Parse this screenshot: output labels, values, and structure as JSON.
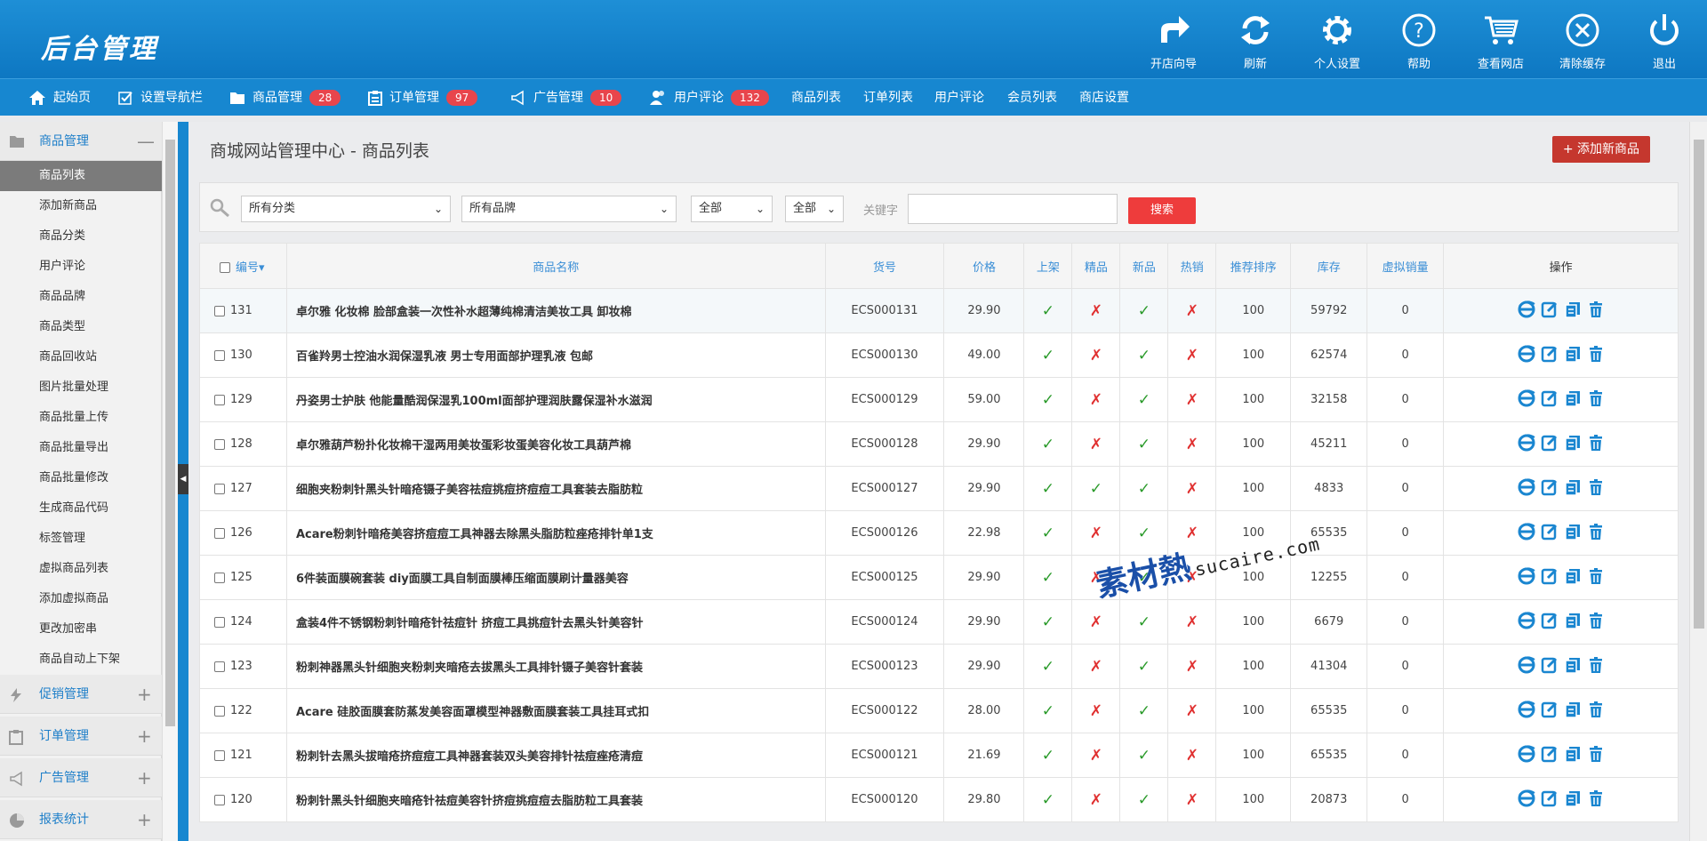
{
  "header": {
    "title": "后台管理",
    "tools": [
      {
        "label": "开店向导",
        "icon": "share-arrow-icon"
      },
      {
        "label": "刷新",
        "icon": "refresh-icon"
      },
      {
        "label": "个人设置",
        "icon": "gear-icon"
      },
      {
        "label": "帮助",
        "icon": "help-icon"
      },
      {
        "label": "查看网店",
        "icon": "cart-icon"
      },
      {
        "label": "清除缓存",
        "icon": "close-circle-icon"
      },
      {
        "label": "退出",
        "icon": "power-icon"
      }
    ]
  },
  "nav": {
    "items": [
      {
        "label": "起始页",
        "icon": "home-icon"
      },
      {
        "label": "设置导航栏",
        "icon": "checkbox-icon"
      },
      {
        "label": "商品管理",
        "icon": "folder-icon",
        "badge": "28"
      },
      {
        "label": "订单管理",
        "icon": "clipboard-icon",
        "badge": "97"
      },
      {
        "label": "广告管理",
        "icon": "megaphone-icon",
        "badge": "10"
      },
      {
        "label": "用户评论",
        "icon": "users-icon",
        "badge": "132"
      },
      {
        "label": "商品列表"
      },
      {
        "label": "订单列表"
      },
      {
        "label": "用户评论"
      },
      {
        "label": "会员列表"
      },
      {
        "label": "商店设置"
      }
    ]
  },
  "sidebar": {
    "groups": [
      {
        "label": "商品管理",
        "toggle": "—",
        "icon": "folder-icon"
      },
      {
        "label": "促销管理",
        "toggle": "+",
        "icon": "bolt-icon"
      },
      {
        "label": "订单管理",
        "toggle": "+",
        "icon": "clipboard-icon"
      },
      {
        "label": "广告管理",
        "toggle": "+",
        "icon": "megaphone-icon"
      },
      {
        "label": "报表统计",
        "toggle": "+",
        "icon": "pie-chart-icon"
      }
    ],
    "items": [
      "商品列表",
      "添加新商品",
      "商品分类",
      "用户评论",
      "商品品牌",
      "商品类型",
      "商品回收站",
      "图片批量处理",
      "商品批量上传",
      "商品批量导出",
      "商品批量修改",
      "生成商品代码",
      "标签管理",
      "虚拟商品列表",
      "添加虚拟商品",
      "更改加密串",
      "商品自动上下架"
    ],
    "active_item": "商品列表"
  },
  "page": {
    "breadcrumb": "商城网站管理中心 - 商品列表",
    "add_button": "添加新商品",
    "add_button_icon": "+"
  },
  "filter": {
    "category": "所有分类",
    "brand": "所有品牌",
    "status1": "全部",
    "status2": "全部",
    "keyword_label": "关键字",
    "keyword_value": "",
    "search_button": "搜索"
  },
  "table": {
    "headers": [
      "编号",
      "商品名称",
      "货号",
      "价格",
      "上架",
      "精品",
      "新品",
      "热销",
      "推荐排序",
      "库存",
      "虚拟销量",
      "操作"
    ],
    "sort_indicator": "▾",
    "yes_mark": "✓",
    "no_mark": "✗",
    "rows": [
      {
        "id": "131",
        "name": "卓尔雅 化妆棉 脸部盒装一次性补水超薄纯棉清洁美妆工具 卸妆棉",
        "sn": "ECS000131",
        "price": "29.90",
        "onsale": true,
        "best": false,
        "new": true,
        "hot": false,
        "sort": "100",
        "stock": "59792",
        "virtual": "0"
      },
      {
        "id": "130",
        "name": "百雀羚男士控油水润保湿乳液 男士专用面部护理乳液 包邮",
        "sn": "ECS000130",
        "price": "49.00",
        "onsale": true,
        "best": false,
        "new": true,
        "hot": false,
        "sort": "100",
        "stock": "62574",
        "virtual": "0"
      },
      {
        "id": "129",
        "name": "丹姿男士护肤 他能量酷润保湿乳100ml面部护理润肤露保湿补水滋润",
        "sn": "ECS000129",
        "price": "59.00",
        "onsale": true,
        "best": false,
        "new": true,
        "hot": false,
        "sort": "100",
        "stock": "32158",
        "virtual": "0"
      },
      {
        "id": "128",
        "name": "卓尔雅葫芦粉扑化妆棉干湿两用美妆蛋彩妆蛋美容化妆工具葫芦棉",
        "sn": "ECS000128",
        "price": "29.90",
        "onsale": true,
        "best": false,
        "new": true,
        "hot": false,
        "sort": "100",
        "stock": "45211",
        "virtual": "0"
      },
      {
        "id": "127",
        "name": "细胞夹粉刺针黑头针暗疮镊子美容祛痘挑痘挤痘痘工具套装去脂肪粒",
        "sn": "ECS000127",
        "price": "29.90",
        "onsale": true,
        "best": true,
        "new": true,
        "hot": false,
        "sort": "100",
        "stock": "4833",
        "virtual": "0"
      },
      {
        "id": "126",
        "name": "Acare粉刺针暗疮美容挤痘痘工具神器去除黑头脂肪粒痤疮排针单1支",
        "sn": "ECS000126",
        "price": "22.98",
        "onsale": true,
        "best": false,
        "new": true,
        "hot": false,
        "sort": "100",
        "stock": "65535",
        "virtual": "0"
      },
      {
        "id": "125",
        "name": "6件装面膜碗套装 diy面膜工具自制面膜棒压缩面膜刷计量器美容",
        "sn": "ECS000125",
        "price": "29.90",
        "onsale": true,
        "best": false,
        "new": true,
        "hot": false,
        "sort": "100",
        "stock": "12255",
        "virtual": "0"
      },
      {
        "id": "124",
        "name": "盒装4件不锈钢粉刺针暗疮针祛痘针 挤痘工具挑痘针去黑头针美容针",
        "sn": "ECS000124",
        "price": "29.90",
        "onsale": true,
        "best": false,
        "new": true,
        "hot": false,
        "sort": "100",
        "stock": "6679",
        "virtual": "0"
      },
      {
        "id": "123",
        "name": "粉刺神器黑头针细胞夹粉刺夹暗疮去拔黑头工具排针镊子美容针套装",
        "sn": "ECS000123",
        "price": "29.90",
        "onsale": true,
        "best": false,
        "new": true,
        "hot": false,
        "sort": "100",
        "stock": "41304",
        "virtual": "0"
      },
      {
        "id": "122",
        "name": "Acare 硅胶面膜套防蒸发美容面罩模型神器敷面膜套装工具挂耳式扣",
        "sn": "ECS000122",
        "price": "28.00",
        "onsale": true,
        "best": false,
        "new": true,
        "hot": false,
        "sort": "100",
        "stock": "65535",
        "virtual": "0"
      },
      {
        "id": "121",
        "name": "粉刺针去黑头拔暗疮挤痘痘工具神器套装双头美容排针祛痘痤疮清痘",
        "sn": "ECS000121",
        "price": "21.69",
        "onsale": true,
        "best": false,
        "new": true,
        "hot": false,
        "sort": "100",
        "stock": "65535",
        "virtual": "0"
      },
      {
        "id": "120",
        "name": "粉刺针黑头针细胞夹暗疮针祛痘美容针挤痘挑痘痘去脂肪粒工具套装",
        "sn": "ECS000120",
        "price": "29.80",
        "onsale": true,
        "best": false,
        "new": true,
        "hot": false,
        "sort": "100",
        "stock": "20873",
        "virtual": "0"
      }
    ]
  },
  "watermark": {
    "brand": "素材熱",
    "site": "sucaire.com"
  },
  "colors": {
    "header_blue": "#1787d0",
    "badge_red": "#e8454c",
    "add_button": "#c5372e",
    "search_button": "#ee3c3c",
    "yes": "#2a9a2a",
    "no": "#e03030"
  }
}
